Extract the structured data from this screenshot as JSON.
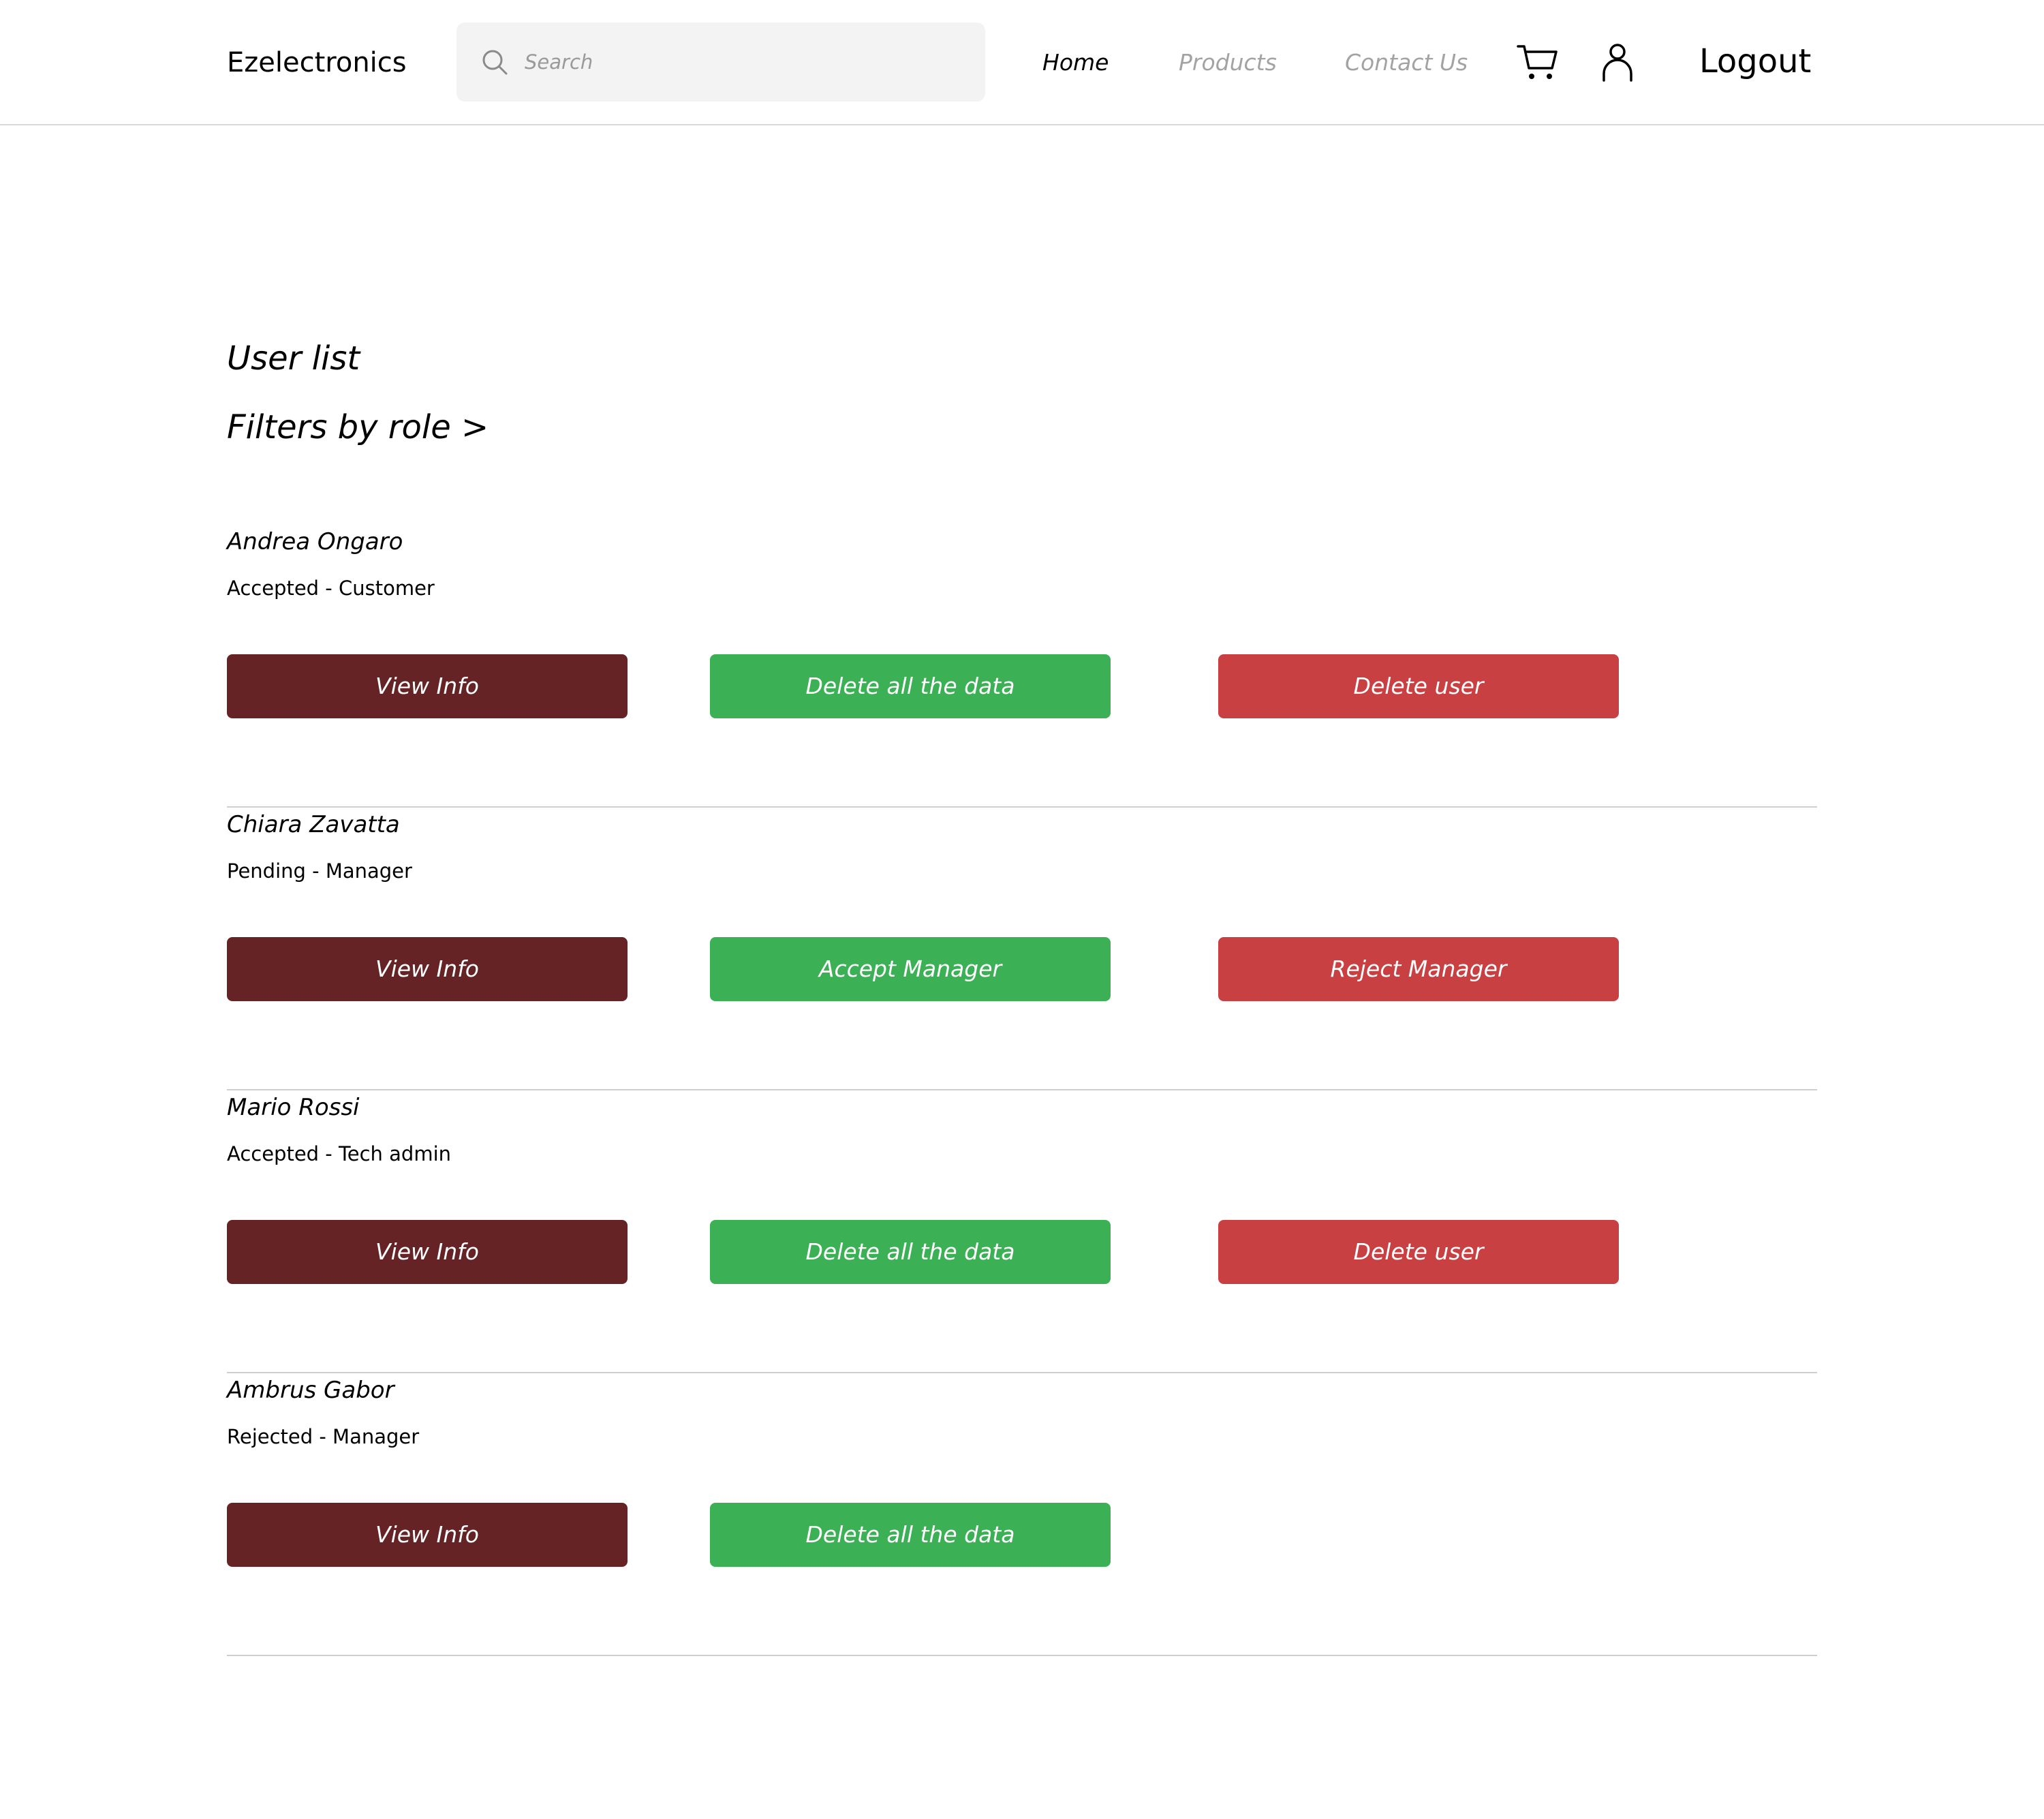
{
  "header": {
    "brand": "Ezelectronics",
    "search": {
      "placeholder": "Search",
      "value": ""
    },
    "nav": {
      "home": "Home",
      "products": "Products",
      "contact": "Contact Us"
    },
    "icons": {
      "cart": "cart-icon",
      "user": "user-icon",
      "search": "search-icon"
    },
    "logout": "Logout"
  },
  "main": {
    "title": "User list",
    "filters": "Filters by role >",
    "users": [
      {
        "name": "Andrea Ongaro",
        "status": "Accepted  -  Customer",
        "buttons": {
          "view": "View Info",
          "green": "Delete all the data",
          "red": "Delete user"
        }
      },
      {
        "name": "Chiara Zavatta",
        "status": "Pending  -  Manager",
        "buttons": {
          "view": "View Info",
          "green": "Accept Manager",
          "red": "Reject Manager"
        }
      },
      {
        "name": "Mario Rossi",
        "status": "Accepted  -  Tech admin",
        "buttons": {
          "view": "View Info",
          "green": "Delete all the data",
          "red": "Delete user"
        }
      },
      {
        "name": "Ambrus Gabor",
        "status": "Rejected  -  Manager",
        "buttons": {
          "view": "View Info",
          "green": "Delete all the data"
        }
      }
    ]
  },
  "colors": {
    "view_button": "#652326",
    "green_button": "#3cb055",
    "red_button": "#c94042",
    "nav_inactive": "#a3a3a3",
    "divider": "#cfcfcf"
  }
}
